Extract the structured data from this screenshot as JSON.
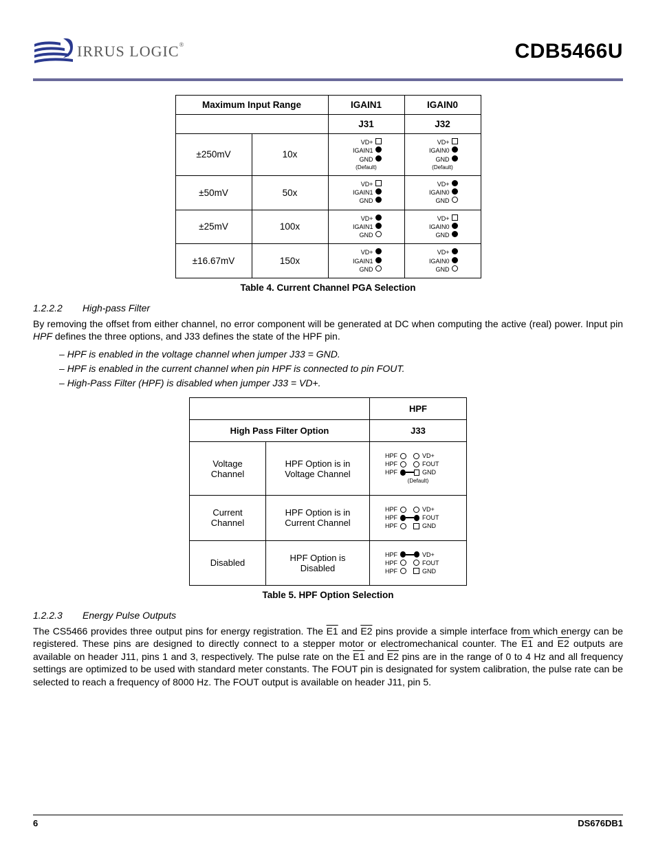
{
  "header": {
    "logo_text": "IRRUS LOGIC",
    "part_number": "CDB5466U"
  },
  "table4": {
    "header_mir": "Maximum Input Range",
    "header_igain1": "IGAIN1",
    "header_igain0": "IGAIN0",
    "sub_j31": "J31",
    "sub_j32": "J32",
    "default_label": "(Default)",
    "rows": [
      {
        "range": "±250mV",
        "gain": "10x",
        "j31": {
          "vd": "sq",
          "mid": "circf",
          "gnd": "circf",
          "def": true
        },
        "j32": {
          "vd": "sq",
          "mid": "circf",
          "gnd": "circf",
          "def": true
        }
      },
      {
        "range": "±50mV",
        "gain": "50x",
        "j31": {
          "vd": "sq",
          "mid": "circf",
          "gnd": "circf",
          "def": false
        },
        "j32": {
          "vd": "circf",
          "mid": "circf",
          "gnd": "circ",
          "def": false
        }
      },
      {
        "range": "±25mV",
        "gain": "100x",
        "j31": {
          "vd": "circf",
          "mid": "circf",
          "gnd": "circ",
          "def": false
        },
        "j32": {
          "vd": "sq",
          "mid": "circf",
          "gnd": "circf",
          "def": false
        }
      },
      {
        "range": "±16.67mV",
        "gain": "150x",
        "j31": {
          "vd": "circf",
          "mid": "circf",
          "gnd": "circ",
          "def": false
        },
        "j32": {
          "vd": "circf",
          "mid": "circf",
          "gnd": "circ",
          "def": false
        }
      }
    ],
    "labels": {
      "vd": "VD+",
      "igain1": "IGAIN1",
      "igain0": "IGAIN0",
      "gnd": "GND"
    },
    "caption": "Table 4. Current Channel PGA Selection"
  },
  "sec_1222": {
    "num": "1.2.2.2",
    "title": "High-pass Filter",
    "para": "By removing the offset from either channel, no error component will be generated at DC when computing the active (real) power. Input pin HPF defines the three options, and J33 defines the state of the HPF pin.",
    "hpf_word": "HPF",
    "bullets": [
      "HPF is enabled in the voltage channel when jumper J33 = GND.",
      "HPF is enabled in the current channel when pin HPF is connected to pin FOUT.",
      "High-Pass Filter (HPF) is disabled when jumper J33 = VD+."
    ]
  },
  "table5": {
    "header_hpf": "HPF",
    "header_option": "High Pass Filter Option",
    "header_j33": "J33",
    "labels": {
      "hpf": "HPF",
      "vd": "VD+",
      "fout": "FOUT",
      "gnd": "GND"
    },
    "default_label": "(Default)",
    "rows": [
      {
        "c1": "Voltage Channel",
        "c2": "HPF Option is in Voltage Channel",
        "conn": "gnd"
      },
      {
        "c1": "Current Channel",
        "c2": "HPF Option is in Current Channel",
        "conn": "fout"
      },
      {
        "c1": "Disabled",
        "c2": "HPF Option is Disabled",
        "conn": "vd"
      }
    ],
    "caption": "Table 5. HPF Option Selection"
  },
  "sec_1223": {
    "num": "1.2.2.3",
    "title": "Energy Pulse Outputs",
    "para_parts": {
      "p1": "The CS5466 provides three output pins for energy registration. The ",
      "e1": "E1",
      "p2": " and ",
      "e2": "E2",
      "p3": " pins provide a simple interface from which energy can be registered. These pins are designed to directly connect to a stepper motor or electromechanical counter. The ",
      "p4": " outputs are available on header J11, pins 1 and 3, respectively. The pulse rate on the ",
      "p5": " pins are in the range of 0 to 4 Hz and all frequency settings are optimized to be used with standard meter constants. The FOUT pin is designated for system calibration, the pulse rate can be selected to reach a frequency of 8000 Hz. The FOUT output is available on header J11, pin 5."
    }
  },
  "footer": {
    "page": "6",
    "doc": "DS676DB1"
  }
}
